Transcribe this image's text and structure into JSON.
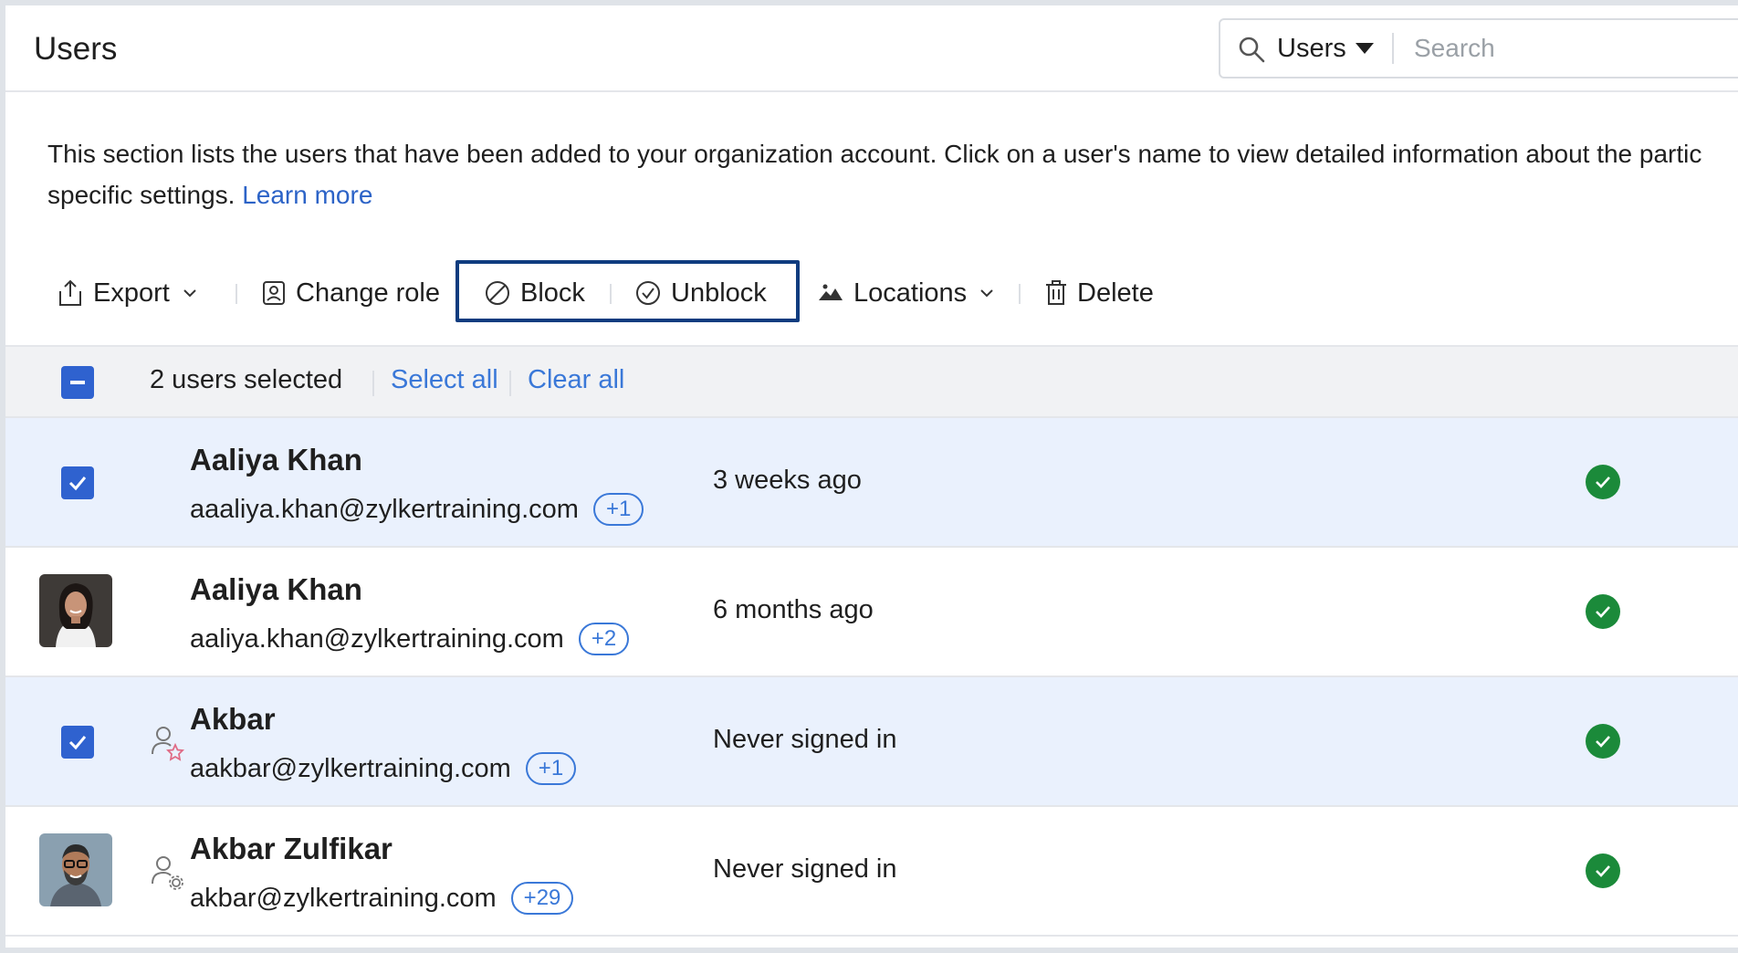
{
  "header": {
    "title": "Users",
    "search_scope": "Users",
    "search_placeholder": "Search"
  },
  "description": {
    "text": "This section lists the users that have been added to your organization account. Click on a user's name to view detailed information about the partic",
    "text_line2": "specific settings.",
    "learn_more": "Learn more"
  },
  "toolbar": {
    "export": "Export",
    "change_role": "Change role",
    "block": "Block",
    "unblock": "Unblock",
    "locations": "Locations",
    "delete": "Delete"
  },
  "selection": {
    "count_label": "2 users selected",
    "select_all": "Select all",
    "clear_all": "Clear all"
  },
  "users": [
    {
      "name": "Aaliya Khan",
      "email": "aaaliya.khan@zylkertraining.com",
      "badge": "+1",
      "last_sign_in": "3 weeks ago",
      "selected": true,
      "status": "active"
    },
    {
      "name": "Aaliya Khan",
      "email": "aaliya.khan@zylkertraining.com",
      "badge": "+2",
      "last_sign_in": "6 months ago",
      "selected": false,
      "status": "active",
      "avatar": "female-avatar"
    },
    {
      "name": "Akbar",
      "email": "aakbar@zylkertraining.com",
      "badge": "+1",
      "last_sign_in": "Never signed in",
      "selected": true,
      "status": "active",
      "role_icon": "user-star-icon"
    },
    {
      "name": "Akbar Zulfikar",
      "email": "akbar@zylkertraining.com",
      "badge": "+29",
      "last_sign_in": "Never signed in",
      "selected": false,
      "status": "active",
      "avatar": "male-avatar",
      "role_icon": "user-gear-icon"
    }
  ],
  "colors": {
    "accent": "#2f62cf",
    "link": "#3a78d8",
    "highlight_border": "#0f3c7f",
    "status_active": "#1b8a3a",
    "selected_row": "#eaf1fd"
  }
}
